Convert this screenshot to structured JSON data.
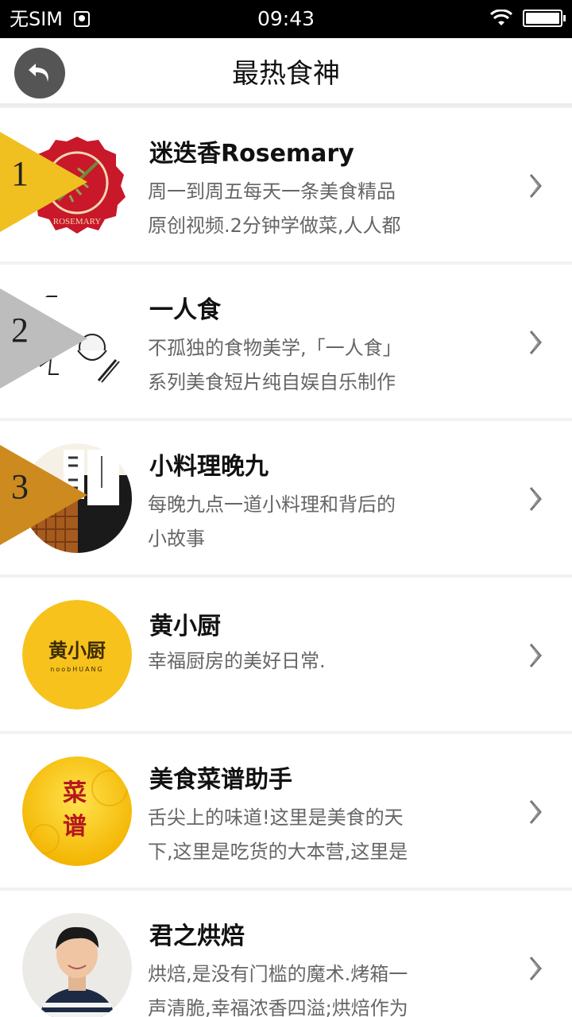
{
  "status": {
    "carrier": "无SIM",
    "time": "09:43"
  },
  "header": {
    "title": "最热食神"
  },
  "colors": {
    "rank1": "#f0c020",
    "rank2": "#bdbdbd",
    "rank3": "#cd8a1e"
  },
  "items": [
    {
      "rank": "1",
      "title": "迷迭香Rosemary",
      "desc1": "周一到周五每天一条美食精品",
      "desc2": "原创视频.2分钟学做菜,人人都",
      "logo_text": "ROSEMARY"
    },
    {
      "rank": "2",
      "title": "一人食",
      "desc1": "不孤独的食物美学,「一人食」",
      "desc2": "系列美食短片纯自娱自乐制作"
    },
    {
      "rank": "3",
      "title": "小料理晚九",
      "desc1": "每晚九点一道小料理和背后的",
      "desc2": "小故事"
    },
    {
      "rank": "",
      "title": "黄小厨",
      "desc1": "幸福厨房的美好日常.",
      "desc2": "",
      "logo_text": "黄小厨",
      "logo_sub": "noobHUANG"
    },
    {
      "rank": "",
      "title": "美食菜谱助手",
      "desc1": "舌尖上的味道!这里是美食的天",
      "desc2": "下,这里是吃货的大本营,这里是",
      "logo_text1": "菜",
      "logo_text2": "谱"
    },
    {
      "rank": "",
      "title": "君之烘焙",
      "desc1": "烘焙,是没有门槛的魔术.烤箱一",
      "desc2": "声清脆,幸福浓香四溢;烘焙作为"
    }
  ]
}
